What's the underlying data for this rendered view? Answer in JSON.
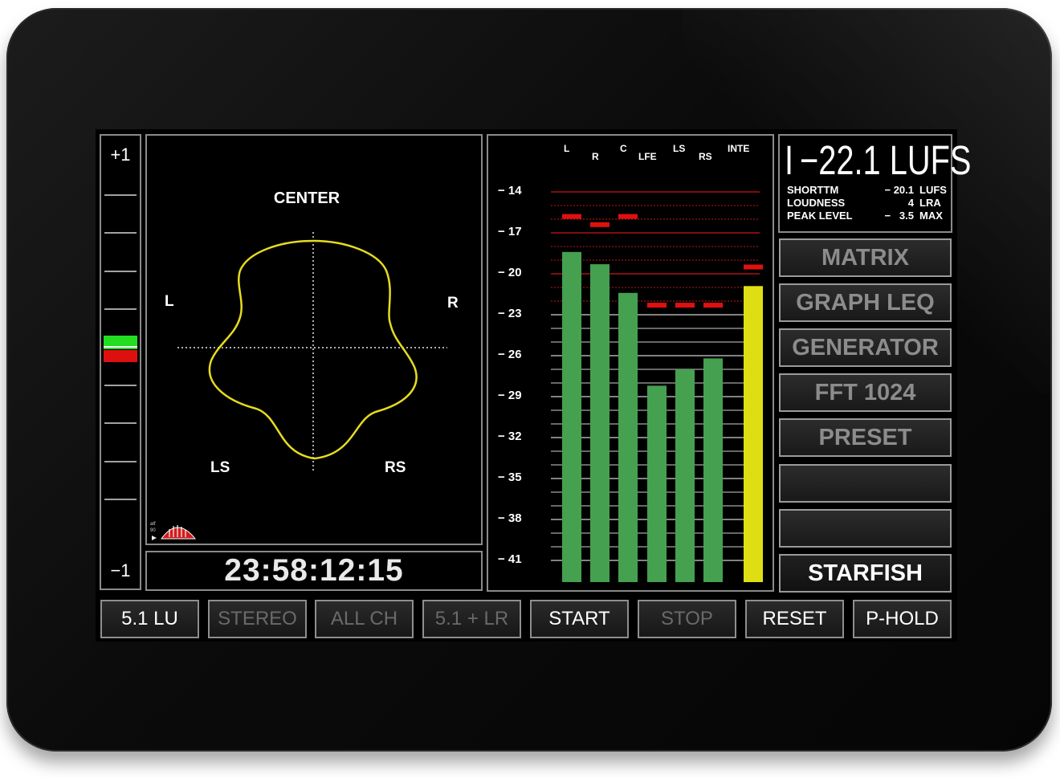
{
  "colors": {
    "bar_green": "#45a050",
    "bar_yellow": "#dede14",
    "peak_red": "#e01010",
    "surround_yellow": "#e6dc1e",
    "corr_green": "#22dd22",
    "corr_red": "#dd1010"
  },
  "correlation": {
    "top_label": "+1",
    "bottom_label": "−1",
    "level": 0.5
  },
  "surround": {
    "center": "CENTER",
    "left": "L",
    "right": "R",
    "left_surround": "LS",
    "right_surround": "RS",
    "logo_icon": "brand-logo-icon"
  },
  "timecode": "23:58:12:15",
  "meter": {
    "channels": [
      "L",
      "R",
      "C",
      "LFE",
      "LS",
      "RS",
      "INTE"
    ],
    "ticks": [
      "− 14",
      "− 17",
      "− 20",
      "− 23",
      "− 26",
      "− 29",
      "− 32",
      "− 35",
      "− 38",
      "− 41"
    ]
  },
  "chart_data": {
    "type": "bar",
    "categories": [
      "L",
      "R",
      "C",
      "LFE",
      "LS",
      "RS",
      "INTE"
    ],
    "values": [
      -18.4,
      -19.3,
      -21.4,
      -28.2,
      -27.0,
      -26.2,
      -20.9
    ],
    "peaks": [
      -15.8,
      -16.4,
      -15.8,
      -22.3,
      -22.3,
      -22.3,
      -19.5
    ],
    "ylim": [
      -43,
      -13
    ],
    "ticks": [
      -14,
      -17,
      -20,
      -23,
      -26,
      -29,
      -32,
      -35,
      -38,
      -41
    ]
  },
  "readout": {
    "integrated": "I −22.1 LUFS",
    "rows": [
      {
        "label": "SHORTTM",
        "value": "− 20.1",
        "unit": "LUFS"
      },
      {
        "label": "LOUDNESS",
        "value": "4",
        "unit": "LRA"
      },
      {
        "label": "PEAK LEVEL",
        "value": "−   3.5",
        "unit": "MAX"
      }
    ]
  },
  "side_buttons": [
    "MATRIX",
    "GRAPH LEQ",
    "GENERATOR",
    "FFT 1024",
    "PRESET",
    "",
    "",
    "STARFISH"
  ],
  "bottom_buttons": [
    "5.1 LU",
    "STEREO",
    "ALL CH",
    "5.1 + LR",
    "START",
    "STOP",
    "RESET",
    "P-HOLD"
  ]
}
